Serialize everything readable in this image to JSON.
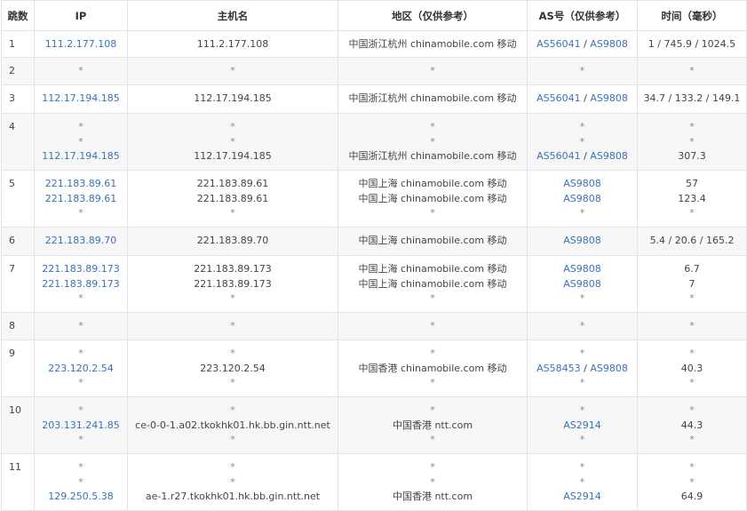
{
  "headers": [
    "跳数",
    "IP",
    "主机名",
    "地区（仅供参考）",
    "AS号（仅供参考）",
    "时间（毫秒）"
  ],
  "rows": [
    {
      "hop": "1",
      "lines": [
        {
          "ip": "111.2.177.108",
          "host": "111.2.177.108",
          "region": "中国浙江杭州 chinamobile.com 移动",
          "as": [
            "AS56041",
            "AS9808"
          ],
          "time": "1 / 745.9 / 1024.5"
        }
      ]
    },
    {
      "hop": "2",
      "lines": [
        {
          "ip": "*",
          "host": "*",
          "region": "*",
          "as": [
            "*"
          ],
          "time": "*"
        }
      ]
    },
    {
      "hop": "3",
      "lines": [
        {
          "ip": "112.17.194.185",
          "host": "112.17.194.185",
          "region": "中国浙江杭州 chinamobile.com 移动",
          "as": [
            "AS56041",
            "AS9808"
          ],
          "time": "34.7 / 133.2 / 149.1"
        }
      ]
    },
    {
      "hop": "4",
      "lines": [
        {
          "ip": "*",
          "host": "*",
          "region": "*",
          "as": [
            "*"
          ],
          "time": "*"
        },
        {
          "ip": "*",
          "host": "*",
          "region": "*",
          "as": [
            "*"
          ],
          "time": "*"
        },
        {
          "ip": "112.17.194.185",
          "host": "112.17.194.185",
          "region": "中国浙江杭州 chinamobile.com 移动",
          "as": [
            "AS56041",
            "AS9808"
          ],
          "time": "307.3"
        }
      ]
    },
    {
      "hop": "5",
      "lines": [
        {
          "ip": "221.183.89.61",
          "host": "221.183.89.61",
          "region": "中国上海 chinamobile.com 移动",
          "as": [
            "AS9808"
          ],
          "time": "57"
        },
        {
          "ip": "221.183.89.61",
          "host": "221.183.89.61",
          "region": "中国上海 chinamobile.com 移动",
          "as": [
            "AS9808"
          ],
          "time": "123.4"
        },
        {
          "ip": "*",
          "host": "*",
          "region": "*",
          "as": [
            "*"
          ],
          "time": "*"
        }
      ]
    },
    {
      "hop": "6",
      "lines": [
        {
          "ip": "221.183.89.70",
          "host": "221.183.89.70",
          "region": "中国上海 chinamobile.com 移动",
          "as": [
            "AS9808"
          ],
          "time": "5.4 / 20.6 / 165.2"
        }
      ]
    },
    {
      "hop": "7",
      "lines": [
        {
          "ip": "221.183.89.173",
          "host": "221.183.89.173",
          "region": "中国上海 chinamobile.com 移动",
          "as": [
            "AS9808"
          ],
          "time": "6.7"
        },
        {
          "ip": "221.183.89.173",
          "host": "221.183.89.173",
          "region": "中国上海 chinamobile.com 移动",
          "as": [
            "AS9808"
          ],
          "time": "7"
        },
        {
          "ip": "*",
          "host": "*",
          "region": "*",
          "as": [
            "*"
          ],
          "time": "*"
        }
      ]
    },
    {
      "hop": "8",
      "lines": [
        {
          "ip": "*",
          "host": "*",
          "region": "*",
          "as": [
            "*"
          ],
          "time": "*"
        }
      ]
    },
    {
      "hop": "9",
      "lines": [
        {
          "ip": "*",
          "host": "*",
          "region": "*",
          "as": [
            "*"
          ],
          "time": "*"
        },
        {
          "ip": "223.120.2.54",
          "host": "223.120.2.54",
          "region": "中国香港 chinamobile.com 移动",
          "as": [
            "AS58453",
            "AS9808"
          ],
          "time": "40.3"
        },
        {
          "ip": "*",
          "host": "*",
          "region": "*",
          "as": [
            "*"
          ],
          "time": "*"
        }
      ]
    },
    {
      "hop": "10",
      "lines": [
        {
          "ip": "*",
          "host": "*",
          "region": "*",
          "as": [
            "*"
          ],
          "time": "*"
        },
        {
          "ip": "203.131.241.85",
          "host": "ce-0-0-1.a02.tkokhk01.hk.bb.gin.ntt.net",
          "region": "中国香港 ntt.com",
          "as": [
            "AS2914"
          ],
          "time": "44.3"
        },
        {
          "ip": "*",
          "host": "*",
          "region": "*",
          "as": [
            "*"
          ],
          "time": "*"
        }
      ]
    },
    {
      "hop": "11",
      "lines": [
        {
          "ip": "*",
          "host": "*",
          "region": "*",
          "as": [
            "*"
          ],
          "time": "*"
        },
        {
          "ip": "*",
          "host": "*",
          "region": "*",
          "as": [
            "*"
          ],
          "time": "*"
        },
        {
          "ip": "129.250.5.38",
          "host": "ae-1.r27.tkokhk01.hk.bb.gin.ntt.net",
          "region": "中国香港 ntt.com",
          "as": [
            "AS2914"
          ],
          "time": "64.9"
        }
      ]
    }
  ]
}
